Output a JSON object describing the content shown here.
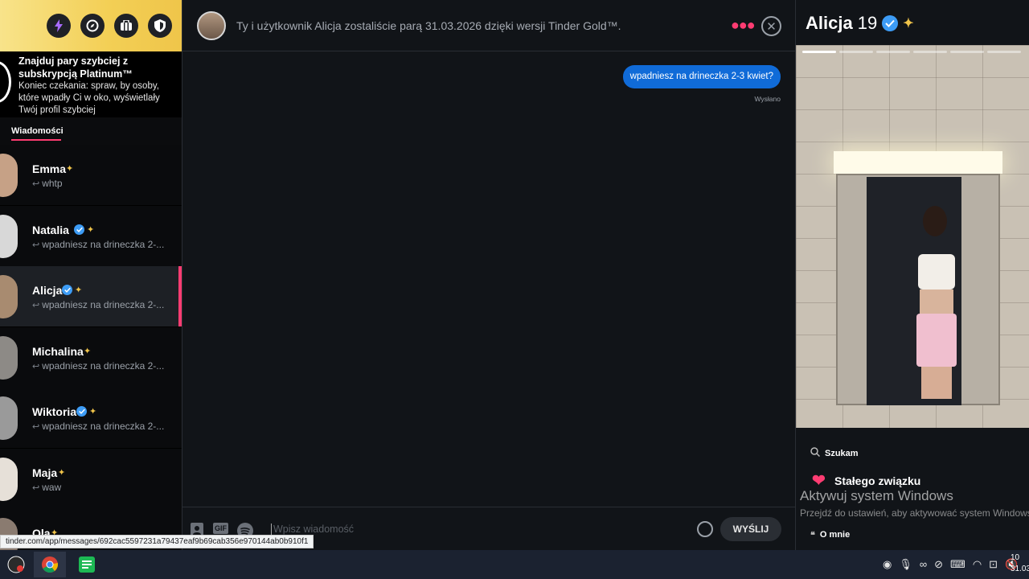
{
  "sidebar": {
    "topbar_icons": [
      "boost-icon",
      "explore-icon",
      "passport-icon",
      "shield-icon"
    ],
    "promo_title": "Znajduj pary szybciej z subskrypcją Platinum™",
    "promo_text": "Koniec czekania: spraw, by osoby, które wpadły Ci w oko, wyświetlały Twój profil szybciej",
    "tab_messages": "Wiadomości",
    "conversations": [
      {
        "name": "Emma",
        "verified": false,
        "snippet": "whtp",
        "avatar": "#c6a186"
      },
      {
        "name": "Natalia",
        "verified": true,
        "snippet": "wpadniesz na drineczka 2-...",
        "avatar": "#d8d8d8"
      },
      {
        "name": "Alicja",
        "verified": true,
        "snippet": "wpadniesz na drineczka 2-...",
        "avatar": "#a88b70",
        "active": true
      },
      {
        "name": "Michalina",
        "verified": false,
        "snippet": "wpadniesz na drineczka 2-...",
        "avatar": "#8d8a86"
      },
      {
        "name": "Wiktoria",
        "verified": true,
        "snippet": "wpadniesz na drineczka 2-...",
        "avatar": "#9a9a9a"
      },
      {
        "name": "Maja",
        "verified": false,
        "snippet": "waw",
        "avatar": "#e6e0d8"
      },
      {
        "name": "Ola",
        "verified": false,
        "snippet": "",
        "avatar": "#8a7b70"
      }
    ]
  },
  "chat": {
    "header_text": "Ty i użytkownik Alicja zostaliście parą 31.03.2026 dzięki wersji Tinder Gold™.",
    "messages": [
      {
        "text": "wpadniesz na drineczka 2-3 kwiet?",
        "status": "Wysłano"
      }
    ],
    "composer_placeholder": "Wpisz wiadomość",
    "composer_icons": [
      "contact-icon",
      "gif-icon",
      "spotify-icon"
    ],
    "gif_label": "GIF",
    "send_label": "WYŚLIJ"
  },
  "profile": {
    "name": "Alicja",
    "age": "19",
    "photo_count": 6,
    "photo_index": 1,
    "looking_for_label": "Szukam",
    "looking_for_value": "Stałego związku",
    "about_label": "O mnie"
  },
  "watermark": {
    "title": "Aktywuj system Windows",
    "subtitle": "Przejdź do ustawień, aby aktywować system Windows."
  },
  "status_url": "tinder.com/app/messages/692cac5597231a79437eaf9b69cab356e970144ab0b910f1",
  "taskbar": {
    "clock_time": "10",
    "clock_date": "31.03"
  },
  "colors": {
    "accent": "#fe3c72",
    "bubble": "#106bd8",
    "gold": "#f0c44a"
  }
}
